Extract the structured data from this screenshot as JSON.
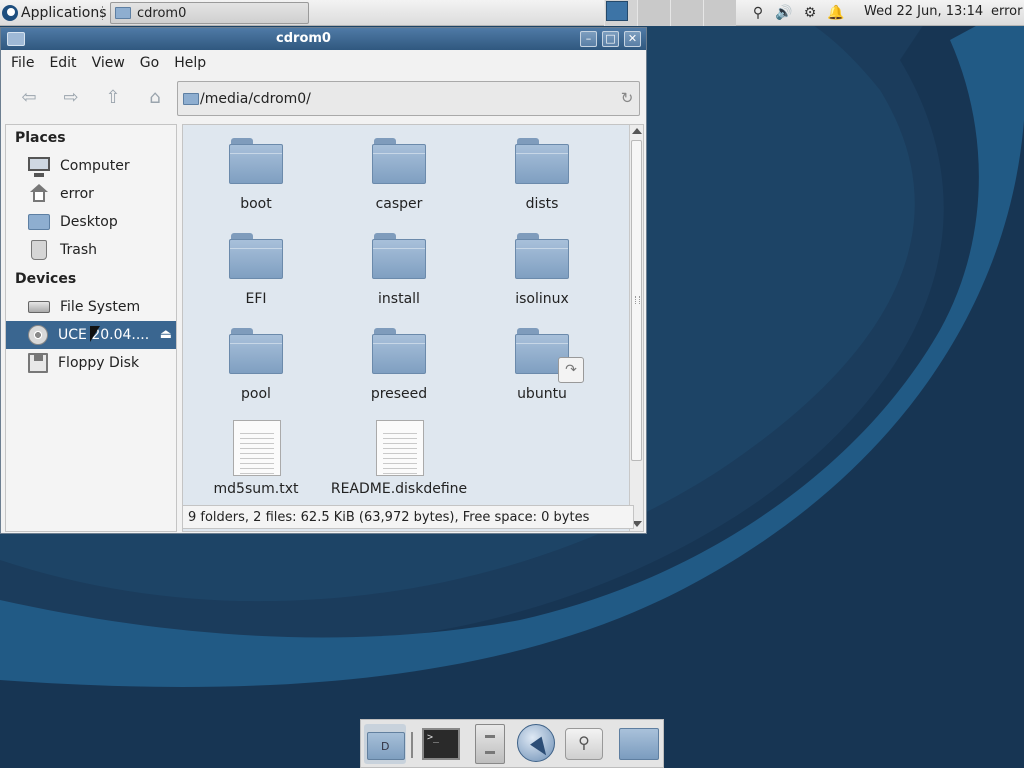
{
  "top_panel": {
    "applications_label": "Applications",
    "task_label": "cdrom0",
    "clock": "Wed 22 Jun, 13:14",
    "user": "error",
    "tray_icons": [
      "search-icon",
      "volume-icon",
      "update-icon",
      "notification-bell-icon"
    ]
  },
  "window": {
    "title": "cdrom0",
    "menu": [
      "File",
      "Edit",
      "View",
      "Go",
      "Help"
    ],
    "toolbar": {
      "buttons": [
        "back-icon",
        "forward-icon",
        "up-icon",
        "home-icon"
      ],
      "location": "/media/cdrom0/"
    },
    "sidebar": {
      "places_heading": "Places",
      "places": [
        {
          "label": "Computer",
          "icon": "computer-icon"
        },
        {
          "label": "error",
          "icon": "home-icon"
        },
        {
          "label": "Desktop",
          "icon": "desktop-icon"
        },
        {
          "label": "Trash",
          "icon": "trash-icon"
        }
      ],
      "devices_heading": "Devices",
      "devices": [
        {
          "label": "File System",
          "icon": "drive-icon"
        },
        {
          "label": "UCE 20.04....",
          "icon": "cd-icon",
          "selected": true
        },
        {
          "label": "Floppy Disk",
          "icon": "floppy-icon"
        }
      ]
    },
    "files": [
      {
        "name": "boot",
        "type": "folder"
      },
      {
        "name": "casper",
        "type": "folder"
      },
      {
        "name": "dists",
        "type": "folder"
      },
      {
        "name": "EFI",
        "type": "folder"
      },
      {
        "name": "install",
        "type": "folder"
      },
      {
        "name": "isolinux",
        "type": "folder"
      },
      {
        "name": "pool",
        "type": "folder"
      },
      {
        "name": "preseed",
        "type": "folder"
      },
      {
        "name": "ubuntu",
        "type": "folder-link"
      },
      {
        "name": "md5sum.txt",
        "type": "file"
      },
      {
        "name": "README.diskdefine",
        "type": "file"
      }
    ],
    "status": "9 folders, 2 files: 62.5 KiB (63,972 bytes), Free space: 0 bytes"
  },
  "dock": {
    "items": [
      "file-manager-icon",
      "terminal-icon",
      "file-cabinet-icon",
      "web-browser-icon",
      "search-app-icon",
      "folder-icon"
    ],
    "terminal_prompt": ">_"
  },
  "colors": {
    "titlebar": "#30587f",
    "selection": "#3a6690",
    "wallpaper_dark": "#1f4a6e",
    "file_area": "#dfe7ef"
  }
}
